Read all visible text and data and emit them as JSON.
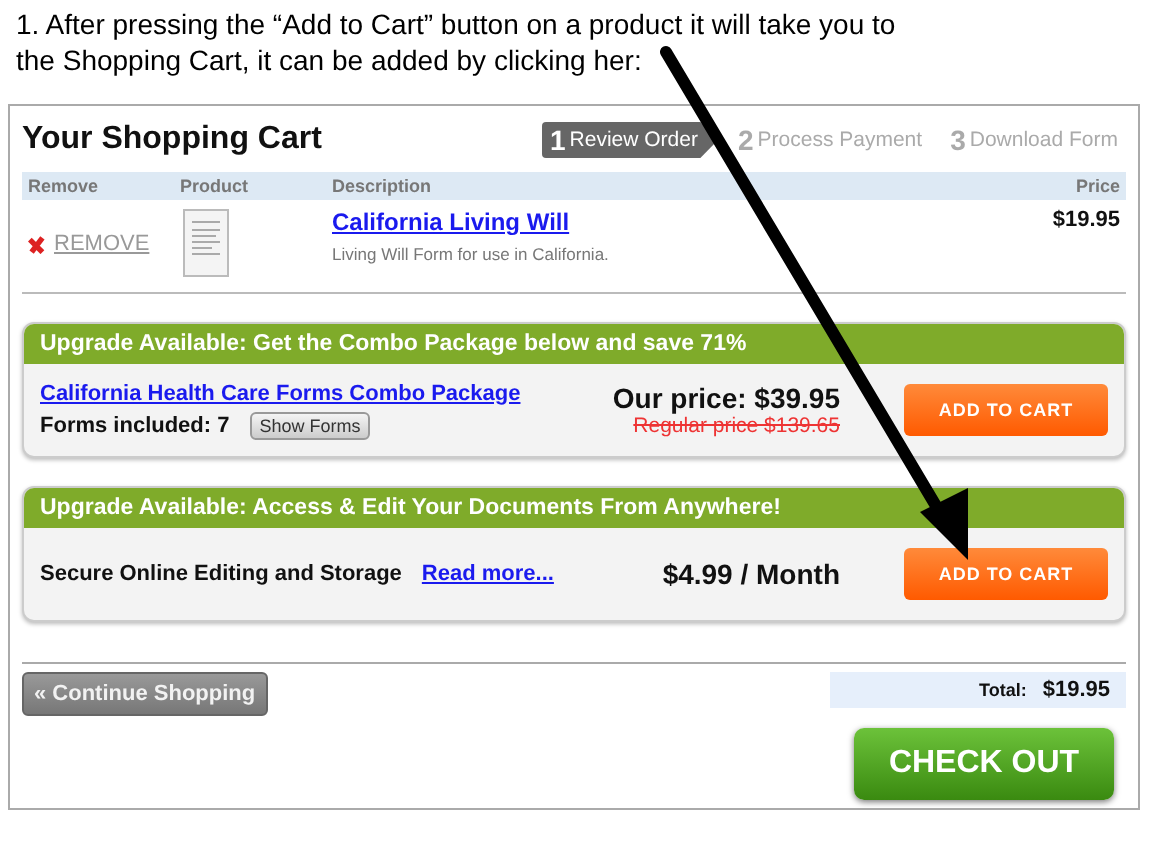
{
  "annotation": "1. After pressing the “Add to Cart” button on a product it will take you to the Shopping Cart, it can be added by clicking her:",
  "cart": {
    "title": "Your Shopping Cart",
    "steps": [
      {
        "number": "1",
        "label": "Review Order",
        "selected": true
      },
      {
        "number": "2",
        "label": "Process Payment",
        "selected": false
      },
      {
        "number": "3",
        "label": "Download Form",
        "selected": false
      }
    ],
    "columns": [
      "Remove",
      "Product",
      "Description",
      "Price"
    ],
    "items": [
      {
        "remove": "REMOVE",
        "name": "California Living Will",
        "description": "Living Will Form for use in California.",
        "price": "$19.95"
      }
    ],
    "upgrades": [
      {
        "kind": "combo",
        "header": "Upgrade Available: Get the Combo Package below and save 71%",
        "link": "California Health Care Forms Combo Package",
        "forms_label": "Forms included: 7",
        "show_forms": "Show Forms",
        "price": "Our price: $39.95",
        "regular_price": "Regular price $139.65",
        "button": "ADD TO CART"
      },
      {
        "kind": "service",
        "header": "Upgrade Available: Access & Edit Your Documents From Anywhere!",
        "text": "Secure Online Editing and Storage",
        "link": "Read more...",
        "price": "$4.99 / Month",
        "button": "ADD TO CART"
      }
    ],
    "continue": "« Continue Shopping",
    "total_label": "Total:",
    "total": "$19.95",
    "checkout": "CHECK OUT"
  }
}
